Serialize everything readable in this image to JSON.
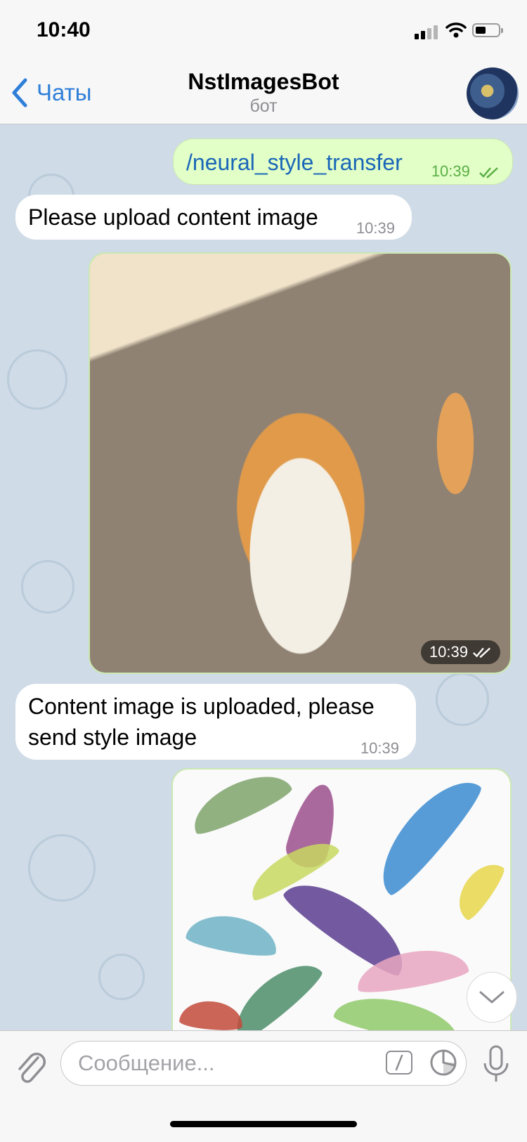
{
  "status": {
    "time": "10:40"
  },
  "nav": {
    "back_label": "Чаты",
    "title": "NstImagesBot",
    "subtitle": "бот"
  },
  "messages": [
    {
      "direction": "outgoing",
      "type": "text",
      "text": "/neural_style_transfer",
      "time": "10:39",
      "read": true
    },
    {
      "direction": "incoming",
      "type": "text",
      "text": "Please upload content image",
      "time": "10:39"
    },
    {
      "direction": "outgoing",
      "type": "photo",
      "time": "10:39",
      "read": true
    },
    {
      "direction": "incoming",
      "type": "text",
      "text_line1": "Content image is uploaded, please",
      "text_line2": "send style image",
      "time": "10:39"
    },
    {
      "direction": "outgoing",
      "type": "photo"
    }
  ],
  "input": {
    "placeholder": "Сообщение..."
  },
  "colors": {
    "accent": "#2f7fd8",
    "outgoing_bubble": "#e1ffc7",
    "incoming_bubble": "#ffffff",
    "chat_background": "#cfdbe6"
  },
  "icons": [
    "chevron-left-icon",
    "double-check-icon",
    "chevron-down-icon",
    "paperclip-icon",
    "slash-command-icon",
    "sticker-icon",
    "microphone-icon"
  ]
}
